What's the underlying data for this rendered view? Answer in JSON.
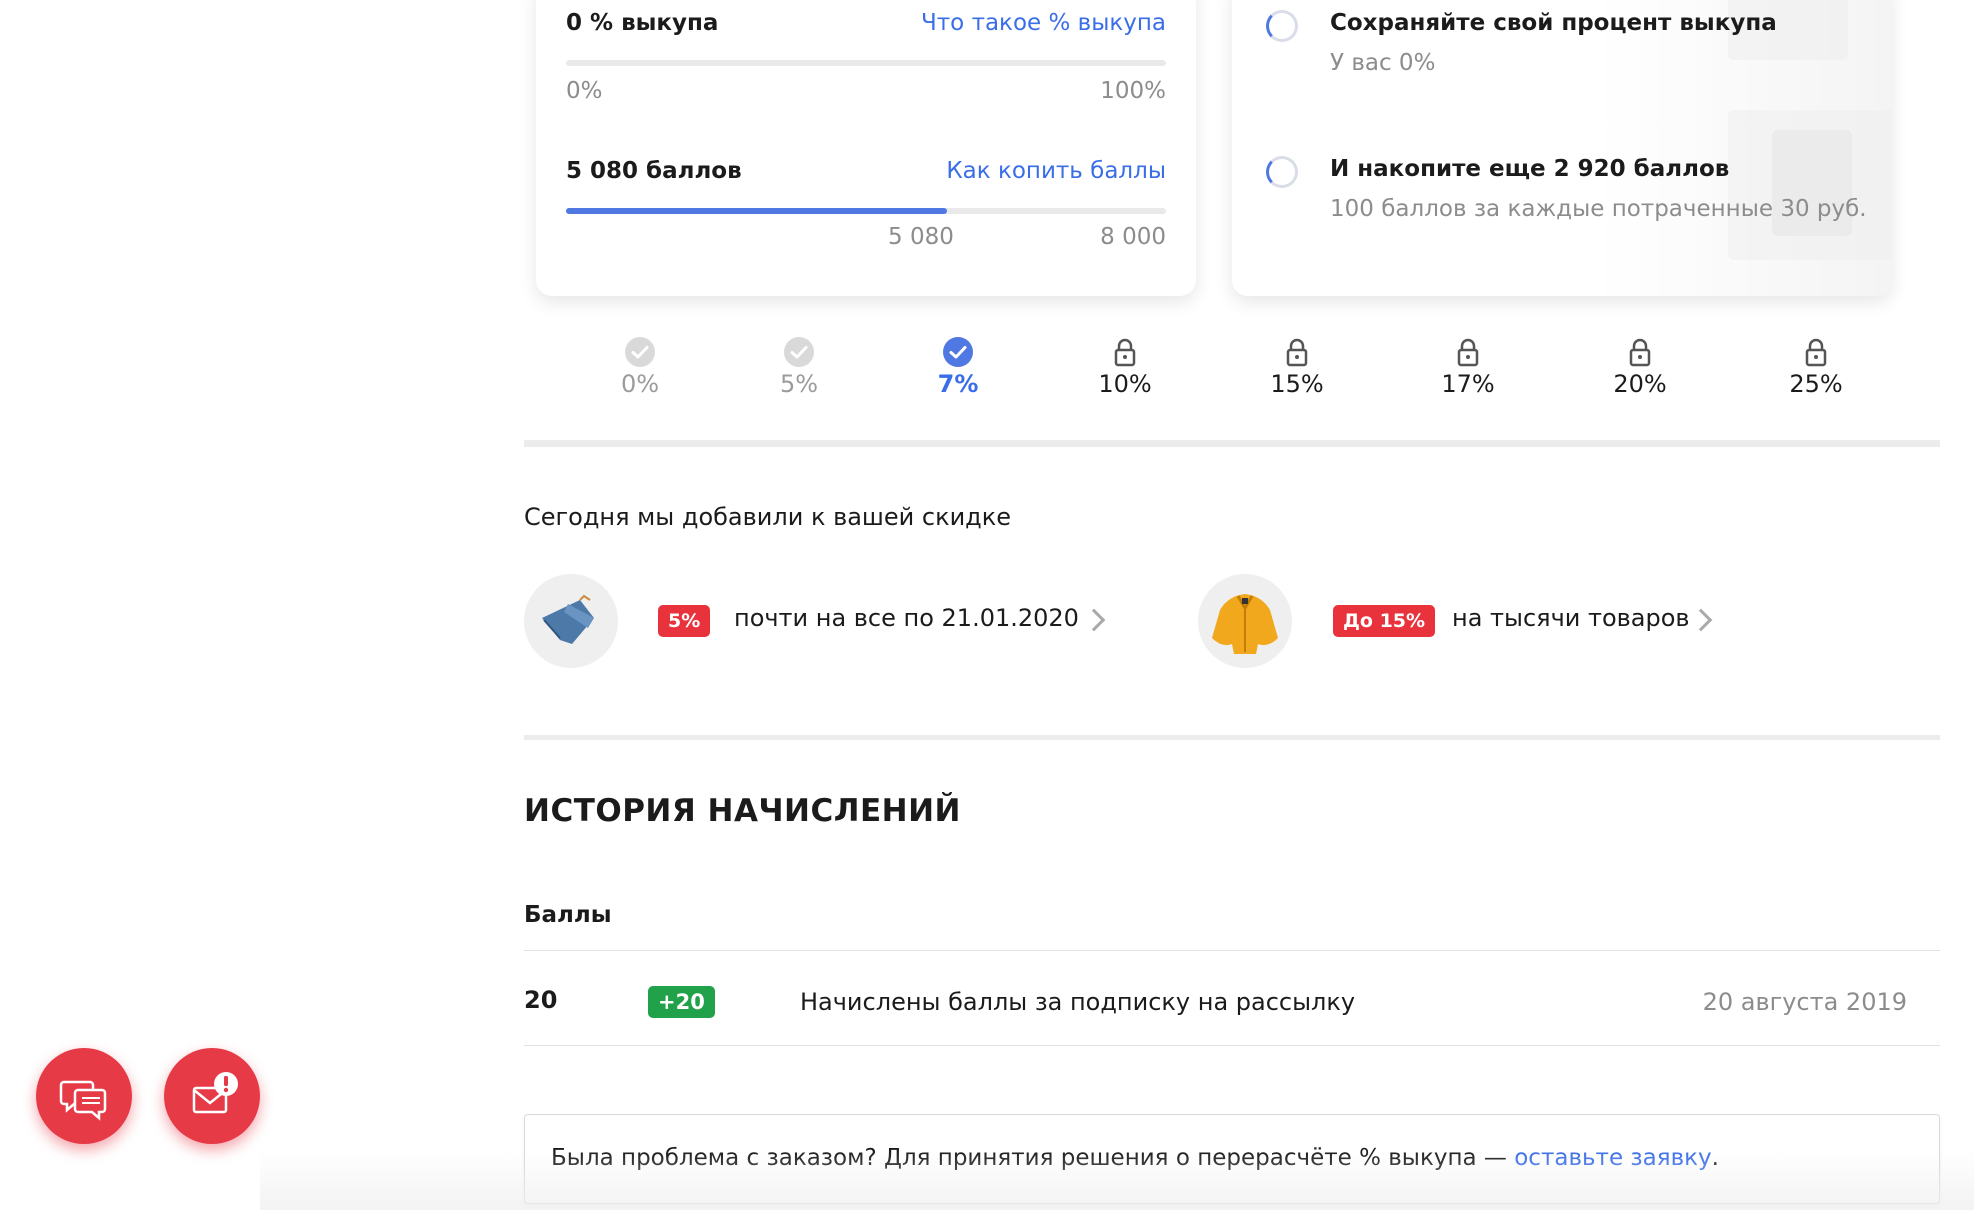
{
  "buyout": {
    "label": "0 % выкупа",
    "link": "Что такое % выкупа",
    "min": "0%",
    "max": "100%",
    "progress": 0
  },
  "points": {
    "label": "5 080 баллов",
    "link": "Как копить баллы",
    "current": "5 080",
    "target": "8 000",
    "progress": 0.635
  },
  "tips": [
    {
      "title": "Сохраняйте свой процент выкупа",
      "subtitle": "У вас 0%"
    },
    {
      "title": "И накопите еще 2 920 баллов",
      "subtitle": "100 баллов за каждые потраченные 30 руб."
    }
  ],
  "levels": [
    {
      "label": "0%",
      "state": "done"
    },
    {
      "label": "5%",
      "state": "done"
    },
    {
      "label": "7%",
      "state": "current"
    },
    {
      "label": "10%",
      "state": "locked"
    },
    {
      "label": "15%",
      "state": "locked"
    },
    {
      "label": "17%",
      "state": "locked"
    },
    {
      "label": "20%",
      "state": "locked"
    },
    {
      "label": "25%",
      "state": "locked"
    }
  ],
  "today": {
    "heading": "Сегодня мы добавили к вашей скидке",
    "promos": [
      {
        "badge": "5%",
        "text": "почти на все по 21.01.2020",
        "image": "jeans-icon"
      },
      {
        "badge": "До 15%",
        "text": "на тысячи товаров",
        "image": "jacket-icon"
      }
    ]
  },
  "history": {
    "heading": "ИСТОРИЯ НАЧИСЛЕНИЙ",
    "column": "Баллы",
    "rows": [
      {
        "points": "20",
        "delta": "+20",
        "description": "Начислены баллы за подписку на рассылку",
        "date": "20 августа 2019"
      }
    ]
  },
  "notice": {
    "text": "Была проблема с заказом? Для принятия решения о перерасчёте % выкупа — ",
    "link": "оставьте заявку",
    "end": "."
  },
  "colors": {
    "accent": "#3a6ee8",
    "badge_red": "#e8333d",
    "badge_green": "#21a24a",
    "fab": "#e63a47"
  },
  "fabs": [
    {
      "icon": "chat-icon"
    },
    {
      "icon": "mail-alert-icon"
    }
  ]
}
